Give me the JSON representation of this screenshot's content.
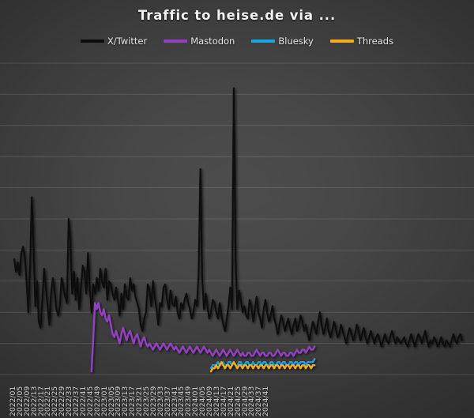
{
  "chart": {
    "title": "Traffic to heise.de via ...",
    "background_color": "#3d3d3d"
  },
  "legend": {
    "position": "top",
    "items": [
      {
        "label": "X/Twitter",
        "color": "#0d0d0d",
        "icon": "line-swatch-icon"
      },
      {
        "label": "Mastodon",
        "color": "#9340c2",
        "icon": "line-swatch-icon"
      },
      {
        "label": "Bluesky",
        "color": "#18a7e0",
        "icon": "line-swatch-icon"
      },
      {
        "label": "Threads",
        "color": "#f5ad1e",
        "icon": "line-swatch-icon"
      }
    ]
  },
  "chart_data": {
    "type": "line",
    "title": "Traffic to heise.de via ...",
    "xlabel": "",
    "ylabel": "",
    "grid": true,
    "gridlines": 10,
    "ylim": [
      0,
      100
    ],
    "x_tick_step": 4,
    "x_tick_labels": [
      "2022/01",
      "2022/05",
      "2022/09",
      "2022/13",
      "2022/17",
      "2022/21",
      "2022/25",
      "2022/29",
      "2022/33",
      "2022/37",
      "2022/41",
      "2022/45",
      "2022/49",
      "2023/01",
      "2023/05",
      "2023/09",
      "2023/13",
      "2023/17",
      "2023/21",
      "2023/25",
      "2023/29",
      "2023/33",
      "2023/37",
      "2023/41",
      "2023/45",
      "2023/49",
      "2024/01",
      "2024/05",
      "2024/09",
      "2024/13",
      "2024/17",
      "2024/21",
      "2024/25",
      "2024/29",
      "2024/33",
      "2024/37",
      "2024/41"
    ],
    "series": [
      {
        "name": "X/Twitter",
        "color": "#0d0d0d",
        "start_index": 0,
        "values": [
          37,
          33,
          36,
          32,
          39,
          41,
          38,
          30,
          20,
          34,
          57,
          41,
          22,
          30,
          17,
          15,
          24,
          34,
          28,
          22,
          16,
          26,
          31,
          27,
          21,
          19,
          22,
          31,
          28,
          25,
          23,
          50,
          43,
          26,
          33,
          24,
          31,
          21,
          28,
          35,
          33,
          26,
          39,
          28,
          20,
          29,
          26,
          31,
          27,
          34,
          30,
          28,
          34,
          24,
          30,
          29,
          26,
          24,
          28,
          24,
          19,
          26,
          21,
          29,
          25,
          24,
          31,
          27,
          29,
          25,
          23,
          21,
          16,
          14,
          18,
          20,
          29,
          27,
          22,
          30,
          25,
          21,
          16,
          23,
          22,
          28,
          29,
          24,
          21,
          27,
          23,
          22,
          25,
          20,
          18,
          23,
          21,
          24,
          26,
          23,
          21,
          18,
          20,
          24,
          22,
          33,
          66,
          31,
          21,
          26,
          22,
          18,
          20,
          24,
          23,
          20,
          18,
          23,
          19,
          16,
          14,
          18,
          22,
          28,
          21,
          92,
          38,
          21,
          27,
          24,
          20,
          22,
          19,
          18,
          24,
          22,
          17,
          21,
          25,
          20,
          18,
          15,
          21,
          24,
          20,
          17,
          19,
          22,
          18,
          16,
          13,
          16,
          19,
          17,
          14,
          16,
          18,
          15,
          13,
          16,
          18,
          14,
          16,
          19,
          17,
          14,
          16,
          13,
          11,
          14,
          17,
          15,
          13,
          17,
          20,
          16,
          13,
          15,
          18,
          14,
          12,
          14,
          17,
          15,
          12,
          13,
          16,
          14,
          12,
          10,
          13,
          15,
          13,
          11,
          13,
          16,
          14,
          11,
          13,
          15,
          12,
          10,
          12,
          14,
          12,
          10,
          12,
          13,
          11,
          9,
          11,
          13,
          11,
          10,
          12,
          14,
          12,
          10,
          12,
          11,
          10,
          11,
          12,
          10,
          9,
          11,
          13,
          11,
          9,
          11,
          13,
          12,
          10,
          12,
          14,
          11,
          9,
          11,
          10,
          12,
          11,
          9,
          10,
          12,
          10,
          9,
          11,
          10,
          9,
          11,
          13,
          11,
          10,
          12,
          13,
          11
        ]
      },
      {
        "name": "Mastodon",
        "color": "#9340c2",
        "start_index": 44,
        "values": [
          1,
          12,
          23,
          21,
          23,
          20,
          19,
          21,
          18,
          17,
          19,
          16,
          13,
          12,
          14,
          12,
          10,
          13,
          15,
          13,
          11,
          13,
          14,
          12,
          10,
          12,
          13,
          11,
          9,
          11,
          12,
          10,
          9,
          10,
          9,
          8,
          9,
          10,
          9,
          8,
          9,
          10,
          9,
          8,
          9,
          10,
          9,
          8,
          9,
          8,
          7,
          8,
          9,
          8,
          7,
          8,
          9,
          8,
          7,
          8,
          9,
          8,
          7,
          8,
          9,
          8,
          7,
          8,
          7,
          6,
          7,
          8,
          7,
          6,
          7,
          8,
          7,
          6,
          7,
          8,
          7,
          6,
          7,
          8,
          7,
          6,
          7,
          6,
          6,
          7,
          7,
          6,
          6,
          7,
          8,
          7,
          6,
          7,
          7,
          6,
          6,
          7,
          7,
          6,
          6,
          7,
          8,
          7,
          6,
          7,
          7,
          6,
          6,
          7,
          7,
          6,
          7,
          8,
          7,
          7,
          8,
          8,
          7,
          8,
          9,
          8,
          8,
          9
        ]
      },
      {
        "name": "Bluesky",
        "color": "#18a7e0",
        "start_index": 112,
        "values": [
          2,
          3,
          3,
          3,
          4,
          3,
          3,
          4,
          3,
          3,
          4,
          4,
          3,
          4,
          3,
          3,
          4,
          4,
          3,
          3,
          4,
          4,
          3,
          3,
          4,
          3,
          3,
          4,
          4,
          3,
          4,
          4,
          3,
          3,
          4,
          4,
          3,
          3,
          4,
          4,
          3,
          4,
          4,
          3,
          3,
          4,
          4,
          3,
          4,
          4,
          3,
          4,
          4,
          4,
          3,
          4,
          4,
          4,
          4,
          5
        ]
      },
      {
        "name": "Threads",
        "color": "#f5ad1e",
        "start_index": 112,
        "values": [
          1,
          2,
          2,
          3,
          2,
          3,
          4,
          3,
          2,
          3,
          3,
          2,
          3,
          4,
          3,
          2,
          3,
          3,
          2,
          3,
          3,
          2,
          3,
          3,
          2,
          3,
          3,
          2,
          3,
          3,
          2,
          3,
          3,
          2,
          3,
          3,
          2,
          3,
          3,
          2,
          3,
          3,
          2,
          3,
          3,
          2,
          3,
          3,
          2,
          3,
          3,
          2,
          3,
          3,
          2,
          3,
          3,
          2,
          3,
          3
        ]
      }
    ]
  }
}
